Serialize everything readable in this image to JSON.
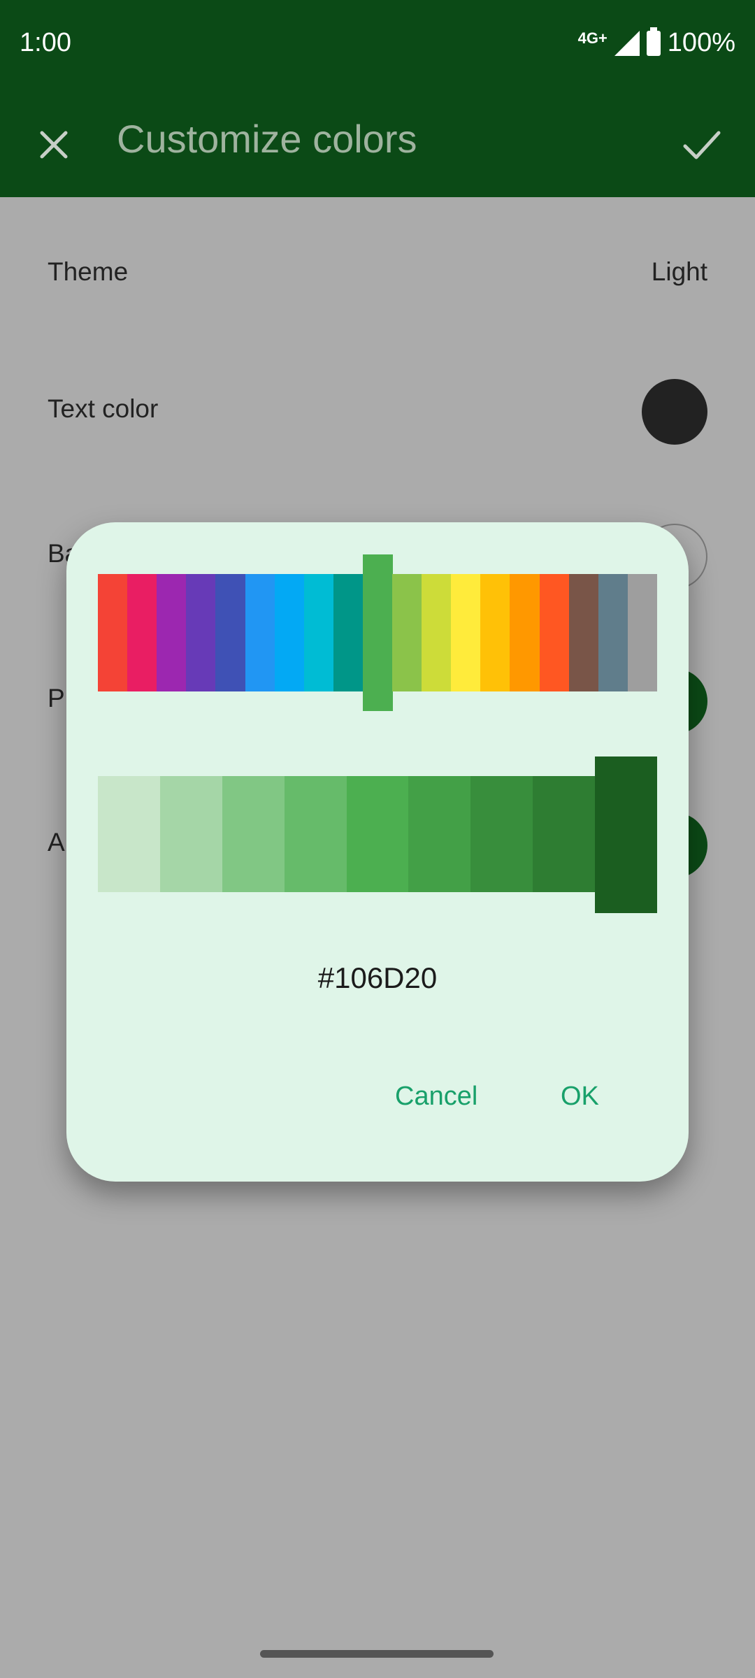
{
  "status_bar": {
    "time": "1:00",
    "network": "4G+",
    "battery": "100%"
  },
  "app_bar": {
    "title": "Customize colors",
    "close_icon": "close-icon",
    "confirm_icon": "check-icon"
  },
  "settings": [
    {
      "label": "Theme",
      "value": "Light"
    },
    {
      "label": "Text color",
      "color": "#222222"
    },
    {
      "label": "Ba",
      "color": "#ffffff"
    },
    {
      "label": "Pr",
      "color": "#0b4a16"
    },
    {
      "label": "A",
      "color": "#0b4a16"
    }
  ],
  "dialog": {
    "hue_colors": [
      "#f44336",
      "#e91e63",
      "#9c27b0",
      "#673ab7",
      "#3f51b5",
      "#2196f3",
      "#03a9f4",
      "#00bcd4",
      "#009688",
      "#4caf50",
      "#8bc34a",
      "#cddc39",
      "#ffeb3b",
      "#ffc107",
      "#ff9800",
      "#ff5722",
      "#795548",
      "#607d8b",
      "#9e9e9e"
    ],
    "hue_selected_index": 9,
    "shade_colors": [
      "#c8e6c9",
      "#a5d6a7",
      "#81c784",
      "#66bb6a",
      "#4caf50",
      "#43a047",
      "#388e3c",
      "#2e7d32",
      "#1b5e20"
    ],
    "shade_selected_index": 8,
    "hex_value": "#106D20",
    "cancel_label": "Cancel",
    "ok_label": "OK"
  }
}
